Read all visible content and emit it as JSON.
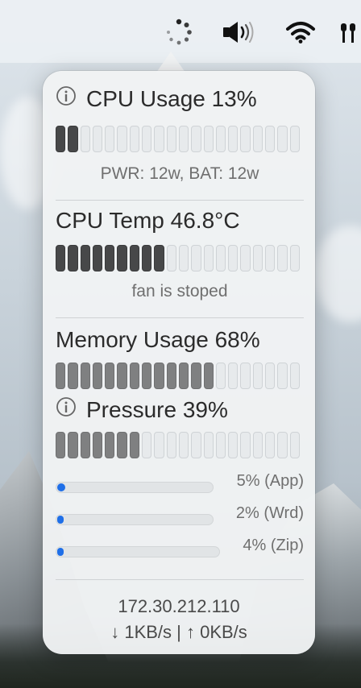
{
  "menubar": {
    "icons": [
      "loading-spinner-icon",
      "speaker-volume-icon",
      "wifi-icon",
      "partial-menubar-icon"
    ]
  },
  "cpu": {
    "title": "CPU Usage 13%",
    "usage_percent": 13,
    "power_text": "PWR: 12w, BAT: 12w",
    "segments_total": 20,
    "segments_filled": 2
  },
  "temp": {
    "title": "CPU Temp 46.8°C",
    "fan_text": "fan is stoped",
    "segments_total": 20,
    "segments_filled": 9
  },
  "memory": {
    "title": "Memory Usage 68%",
    "usage_percent": 68,
    "segments_total": 20,
    "segments_filled": 13
  },
  "pressure": {
    "title": "Pressure 39%",
    "usage_percent": 39,
    "segments_total": 20,
    "segments_filled": 7
  },
  "memory_breakdown": [
    {
      "label": "5% (App)",
      "fraction": 0.05
    },
    {
      "label": "2% (Wrd)",
      "fraction": 0.02
    },
    {
      "label": "4% (Zip)",
      "fraction": 0.04
    }
  ],
  "network": {
    "ip": "172.30.212.110",
    "throughput": "↓ 1KB/s | ↑ 0KB/s"
  },
  "colors": {
    "accent": "#1f6fe8",
    "segment_dark": "#474849",
    "segment_mid": "#7f8081"
  }
}
